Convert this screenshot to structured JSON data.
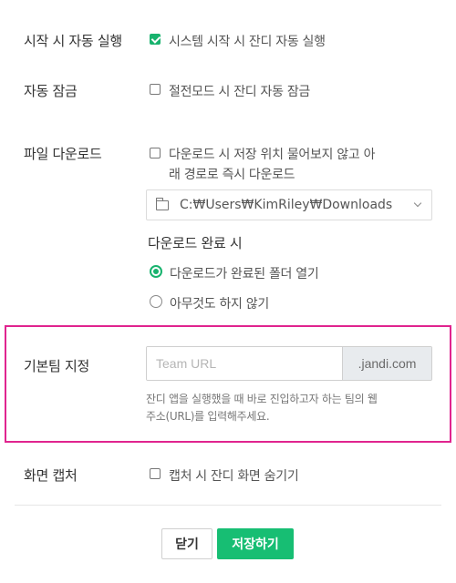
{
  "startup": {
    "label": "시작 시 자동 실행",
    "option_label": "시스템 시작 시 잔디 자동 실행",
    "checked": true
  },
  "auto_lock": {
    "label": "자동 잠금",
    "option_label": "절전모드 시 잔디 자동 잠금",
    "checked": false
  },
  "download": {
    "label": "파일 다운로드",
    "option_label_line1": "다운로드 시 저장 위치 물어보지 않고 아",
    "option_label_line2": "래 경로로 즉시 다운로드",
    "checked": false,
    "path": "C:₩Users₩KimRiley₩Downloads",
    "on_complete_heading": "다운로드 완료 시",
    "on_complete_options": [
      {
        "label": "다운로드가 완료된 폴더 열기",
        "selected": true
      },
      {
        "label": "아무것도 하지 않기",
        "selected": false
      }
    ]
  },
  "default_team": {
    "label": "기본팀 지정",
    "placeholder": "Team URL",
    "value": "",
    "suffix": ".jandi.com",
    "help_line1": "잔디 앱을 실행했을 때 바로 진입하고자 하는 팀의 웹",
    "help_line2": "주소(URL)를 입력해주세요."
  },
  "screen_capture": {
    "label": "화면 캡처",
    "option_label": "캡처 시 잔디 화면 숨기기",
    "checked": false
  },
  "footer": {
    "close_label": "닫기",
    "save_label": "저장하기"
  },
  "colors": {
    "accent": "#17be73",
    "highlight_border": "#e0248f"
  },
  "icons": [
    "checkbox-checked-icon",
    "checkbox-icon",
    "folder-icon",
    "chevron-down-icon",
    "radio-selected-icon",
    "radio-icon"
  ]
}
